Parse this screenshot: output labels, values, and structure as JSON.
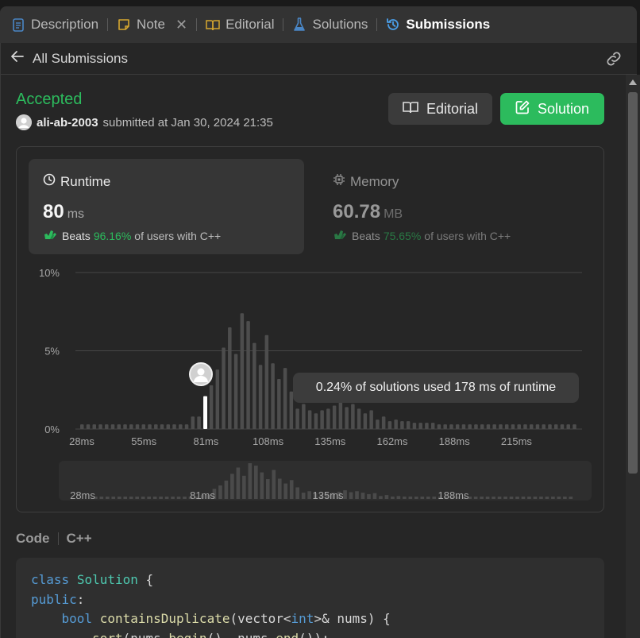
{
  "tabs": [
    {
      "label": "Description",
      "icon": "document-icon",
      "color": "#4a86c5"
    },
    {
      "label": "Note",
      "icon": "note-icon",
      "color": "#d6a730"
    },
    {
      "label": "Editorial",
      "icon": "book-icon",
      "color": "#d6a730"
    },
    {
      "label": "Solutions",
      "icon": "flask-icon",
      "color": "#4a86c5"
    },
    {
      "label": "Submissions",
      "icon": "history-icon",
      "color": "#4a9ee8"
    }
  ],
  "subheader": {
    "back_label": "All Submissions"
  },
  "submission": {
    "status": "Accepted",
    "user": "ali-ab-2003",
    "submitted_text": "submitted at Jan 30, 2024 21:35"
  },
  "buttons": {
    "editorial": "Editorial",
    "solution": "Solution"
  },
  "runtime": {
    "title": "Runtime",
    "value": "80",
    "unit": "ms",
    "beats_prefix": "Beats",
    "beats_pct": "96.16%",
    "beats_suffix": "of users with C++"
  },
  "memory": {
    "title": "Memory",
    "value": "60.78",
    "unit": "MB",
    "beats_prefix": "Beats",
    "beats_pct": "75.65%",
    "beats_suffix": "of users with C++"
  },
  "tooltip": "0.24% of solutions used 178 ms of runtime",
  "code_section": {
    "label": "Code",
    "language": "C++"
  },
  "colors": {
    "accent": "#2cbb5d",
    "bar": "#4d4d4d",
    "bar_active": "#ffffff"
  },
  "chart_data": {
    "type": "bar",
    "ylabel_ticks": [
      "10%",
      "5%",
      "0%"
    ],
    "ylim": [
      0,
      10
    ],
    "x_ticks": [
      "28ms",
      "55ms",
      "81ms",
      "108ms",
      "135ms",
      "162ms",
      "188ms",
      "215ms"
    ],
    "overview_ticks": [
      "28ms",
      "81ms",
      "135ms",
      "188ms"
    ],
    "highlight_index": 20,
    "values": [
      0.3,
      0.3,
      0.3,
      0.3,
      0.3,
      0.3,
      0.3,
      0.3,
      0.3,
      0.3,
      0.3,
      0.3,
      0.3,
      0.3,
      0.3,
      0.3,
      0.3,
      0.3,
      0.8,
      0.8,
      2.1,
      2.8,
      3.8,
      5.2,
      6.5,
      4.8,
      7.4,
      6.9,
      5.5,
      4.1,
      6.0,
      4.2,
      3.2,
      3.9,
      2.4,
      1.3,
      1.6,
      1.2,
      1.0,
      1.2,
      1.3,
      1.5,
      1.8,
      1.4,
      1.6,
      1.3,
      1.0,
      1.2,
      0.6,
      0.8,
      0.5,
      0.6,
      0.5,
      0.5,
      0.4,
      0.4,
      0.4,
      0.4,
      0.3,
      0.3,
      0.3,
      0.3,
      0.3,
      0.3,
      0.3,
      0.3,
      0.3,
      0.3,
      0.3,
      0.3,
      0.3,
      0.3,
      0.3,
      0.3,
      0.3,
      0.3,
      0.3,
      0.3,
      0.3,
      0.3,
      0.3
    ]
  }
}
